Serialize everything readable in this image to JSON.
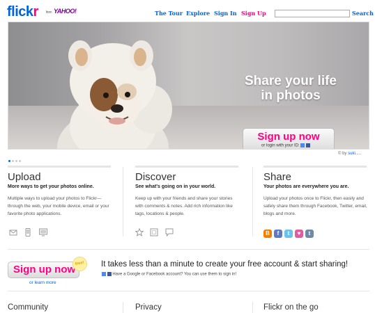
{
  "header": {
    "logo_flick": "flick",
    "logo_r": "r",
    "logo_from": "from",
    "logo_yahoo": "YAHOO!",
    "nav": [
      "The Tour",
      "Explore",
      "Sign In",
      "Sign Up"
    ],
    "search_label": "Search",
    "search_value": ""
  },
  "hero": {
    "tagline_line1": "Share your life",
    "tagline_line2": "in photos",
    "signup_label": "Sign up now",
    "signup_alt": "or login with your ID:",
    "credit_prefix": "© by",
    "credit_author": "suki....."
  },
  "columns": [
    {
      "title": "Upload",
      "subtitle": "More ways to get your photos online.",
      "body": "Multiple ways to upload your photos to Flickr—through the web, your mobile device, email or your favorite photo applications.",
      "icons": [
        "email-icon",
        "mobile-icon",
        "desktop-icon"
      ]
    },
    {
      "title": "Discover",
      "subtitle": "See what's going on in your world.",
      "body": "Keep up with your friends and share your stories with comments & notes. Add rich information like tags, locations & people.",
      "icons": [
        "star-icon",
        "note-icon",
        "comment-icon"
      ]
    },
    {
      "title": "Share",
      "subtitle": "Your photos are everywhere you are.",
      "body": "Upload your photos once to Flickr, then easily and safely share them through Facebook, Twitter, email, blogs and more.",
      "icons": [
        "blogger-icon",
        "facebook-icon",
        "twitter-icon",
        "heart-icon",
        "tumblr-icon"
      ]
    }
  ],
  "cta": {
    "button_label": "Sign up now",
    "badge": "free!",
    "learn_more": "or learn more",
    "title": "It takes less than a minute to create your free account & start sharing!",
    "sub": "Have a Google or Facebook account? You can use them to sign in!"
  },
  "footer_headings": [
    "Community",
    "Privacy",
    "Flickr on the go"
  ],
  "colors": {
    "brand_blue": "#0063dc",
    "brand_pink": "#ff0084"
  }
}
